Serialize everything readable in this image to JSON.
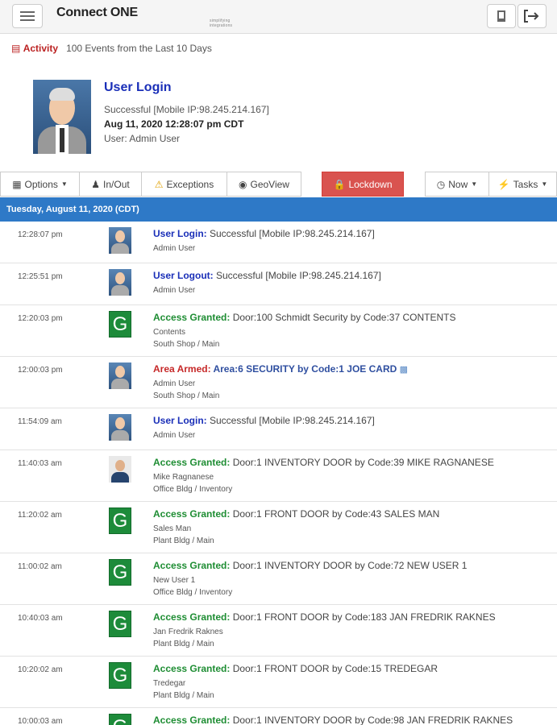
{
  "header": {
    "brand": "Connect",
    "brand_one": "ONE",
    "tagline": "simplifying integrations"
  },
  "activity": {
    "label": "Activity",
    "summary": "100 Events from the Last 10 Days"
  },
  "profile": {
    "title": "User Login",
    "status": "Successful [Mobile IP:98.245.214.167]",
    "datetime": "Aug 11, 2020 12:28:07 pm CDT",
    "user": "User: Admin User"
  },
  "toolbar": {
    "options": "Options",
    "inout": "In/Out",
    "exceptions": "Exceptions",
    "geoview": "GeoView",
    "lockdown": "Lockdown",
    "now": "Now",
    "tasks": "Tasks"
  },
  "day": "Tuesday, August 11, 2020 (CDT)",
  "events": [
    {
      "time": "12:28:07 pm",
      "type": "User Login:",
      "detail": " Successful [Mobile IP:98.245.214.167]",
      "sub1": "Admin User",
      "sub2": ""
    },
    {
      "time": "12:25:51 pm",
      "type": "User Logout:",
      "detail": " Successful [Mobile IP:98.245.214.167]",
      "sub1": "Admin User",
      "sub2": ""
    },
    {
      "time": "12:20:03 pm",
      "type": "Access Granted:",
      "detail": " Door:100 Schmidt Security by Code:37 CONTENTS",
      "sub1": "Contents",
      "sub2": "South Shop / Main"
    },
    {
      "time": "12:00:03 pm",
      "type": "Area Armed:",
      "detail": " Area:6 SECURITY by Code:1 JOE CARD",
      "sub1": "Admin User",
      "sub2": "South Shop / Main"
    },
    {
      "time": "11:54:09 am",
      "type": "User Login:",
      "detail": " Successful [Mobile IP:98.245.214.167]",
      "sub1": "Admin User",
      "sub2": ""
    },
    {
      "time": "11:40:03 am",
      "type": "Access Granted:",
      "detail": " Door:1 INVENTORY DOOR by Code:39 MIKE RAGNANESE",
      "sub1": "Mike Ragnanese",
      "sub2": "Office Bldg / Inventory"
    },
    {
      "time": "11:20:02 am",
      "type": "Access Granted:",
      "detail": " Door:1 FRONT DOOR by Code:43 SALES MAN",
      "sub1": "Sales Man",
      "sub2": "Plant Bldg / Main"
    },
    {
      "time": "11:00:02 am",
      "type": "Access Granted:",
      "detail": " Door:1 INVENTORY DOOR by Code:72 NEW USER 1",
      "sub1": "New User 1",
      "sub2": "Office Bldg / Inventory"
    },
    {
      "time": "10:40:03 am",
      "type": "Access Granted:",
      "detail": " Door:1 FRONT DOOR by Code:183 JAN FREDRIK RAKNES",
      "sub1": "Jan Fredrik Raknes",
      "sub2": "Plant Bldg / Main"
    },
    {
      "time": "10:20:02 am",
      "type": "Access Granted:",
      "detail": " Door:1 FRONT DOOR by Code:15 TREDEGAR",
      "sub1": "Tredegar",
      "sub2": "Plant Bldg / Main"
    },
    {
      "time": "10:00:03 am",
      "type": "Access Granted:",
      "detail": " Door:1 INVENTORY DOOR by Code:98 JAN FREDRIK RAKNES",
      "sub1": "",
      "sub2": ""
    }
  ],
  "colors": {
    "accent": "#2e79c7",
    "lockdown": "#d9534f",
    "granted": "#1e8d33",
    "login": "#1a2fb8",
    "armed": "#c62828"
  }
}
